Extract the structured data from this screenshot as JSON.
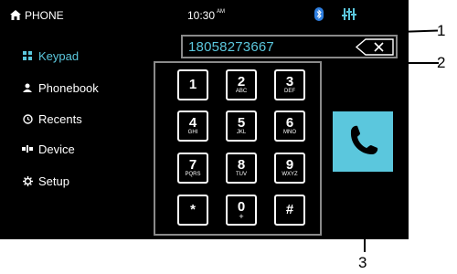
{
  "colors": {
    "accent": "#5bc7dd",
    "background": "#000000",
    "border": "#8a8a8a"
  },
  "status_bar": {
    "title": "PHONE",
    "time": "10:30",
    "ampm": "AM"
  },
  "sidebar": {
    "items": [
      {
        "label": "Keypad",
        "icon": "keypad-icon",
        "active": true
      },
      {
        "label": "Phonebook",
        "icon": "person-icon"
      },
      {
        "label": "Recents",
        "icon": "clock-icon"
      },
      {
        "label": "Device",
        "icon": "device-icon"
      },
      {
        "label": "Setup",
        "icon": "gear-icon"
      }
    ]
  },
  "dial": {
    "number": "18058273667"
  },
  "keypad": {
    "keys": [
      {
        "digit": "1",
        "sub": ""
      },
      {
        "digit": "2",
        "sub": "ABC"
      },
      {
        "digit": "3",
        "sub": "DEF"
      },
      {
        "digit": "4",
        "sub": "GHI"
      },
      {
        "digit": "5",
        "sub": "JKL"
      },
      {
        "digit": "6",
        "sub": "MNO"
      },
      {
        "digit": "7",
        "sub": "PQRS"
      },
      {
        "digit": "8",
        "sub": "TUV"
      },
      {
        "digit": "9",
        "sub": "WXYZ"
      },
      {
        "digit": "*",
        "sub": ""
      },
      {
        "digit": "0",
        "sub": "+"
      },
      {
        "digit": "#",
        "sub": ""
      }
    ]
  },
  "callouts": {
    "c1": "1",
    "c2": "2",
    "c3": "3"
  }
}
